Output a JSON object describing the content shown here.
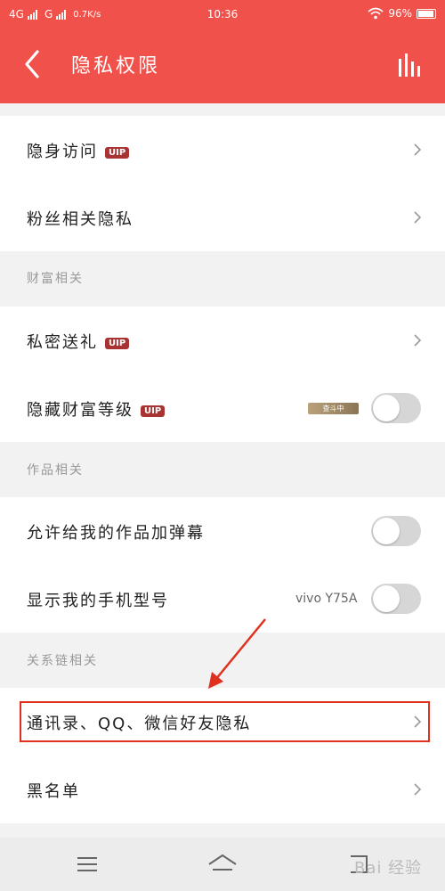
{
  "status_bar": {
    "network_1": "4G",
    "network_2": "G",
    "speed": "0.7K/s",
    "time": "10:36",
    "battery": "96%",
    "icons": [
      "signal-icon",
      "wifi-icon",
      "battery-icon"
    ]
  },
  "header": {
    "title": "隐私权限",
    "back_icon": "back-chevron-icon",
    "stats_icon": "bar-chart-icon"
  },
  "badge_vip": "UIP",
  "sections": {
    "top_items": [
      {
        "label": "隐身访问",
        "vip": true
      },
      {
        "label": "粉丝相关隐私"
      }
    ],
    "wealth": {
      "header": "财富相关",
      "items": [
        {
          "label": "私密送礼",
          "vip": true
        },
        {
          "label": "隐藏财富等级",
          "vip": true,
          "rank_badge": "查斗中",
          "toggle_on": false
        }
      ]
    },
    "works": {
      "header": "作品相关",
      "items": [
        {
          "label": "允许给我的作品加弹幕",
          "toggle_on": false
        },
        {
          "label": "显示我的手机型号",
          "device": "vivo Y75A",
          "toggle_on": false
        }
      ]
    },
    "relations": {
      "header": "关系链相关",
      "items": [
        {
          "label": "通讯录、QQ、微信好友隐私"
        },
        {
          "label": "黑名单"
        }
      ]
    }
  },
  "colors": {
    "accent": "#f0524b",
    "vip_badge": "#a93232",
    "highlight": "#e0301e"
  },
  "nav_bar": {
    "icons": [
      "menu-icon",
      "home-icon",
      "back-icon"
    ]
  },
  "watermark": "Bai 经验"
}
